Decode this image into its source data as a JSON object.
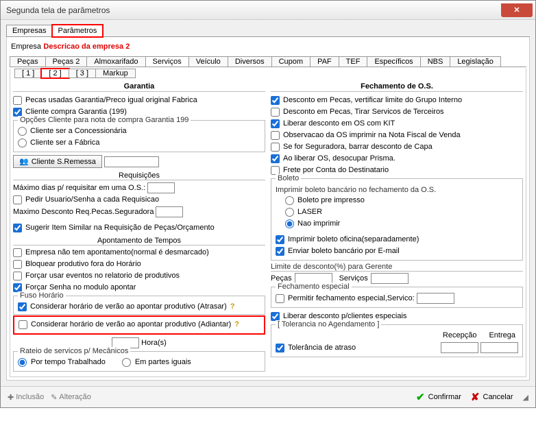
{
  "window": {
    "title": "Segunda tela de parâmetros"
  },
  "topTabs": {
    "empresas": "Empresas",
    "parametros": "Parâmetros"
  },
  "empresa": {
    "label": "Empresa",
    "value": "Descricao da empresa 2"
  },
  "subTabs": {
    "pecas": "Peças",
    "pecas2": "Peças 2",
    "almox": "Almoxarifado",
    "servicos": "Serviços",
    "veiculo": "Veículo",
    "diversos": "Diversos",
    "cupom": "Cupom",
    "paf": "PAF",
    "tef": "TEF",
    "especificos": "Específicos",
    "nbs": "NBS",
    "legislacao": "Legislação"
  },
  "subTabs2": {
    "t1": "[ 1 ]",
    "t2": "[ 2 ]",
    "t3": "[ 3 ]",
    "markup": "Markup"
  },
  "left": {
    "garantia_title": "Garantia",
    "cb_pecas_usadas": "Pecas usadas Garantia/Preco igual original Fabrica",
    "cb_cliente_compra": "Cliente compra Garantia (199)",
    "opc_legend": "Opções Cliente para nota de compra Garantia 199",
    "rb_concess": "Cliente ser a Concessionária",
    "rb_fabrica": "Cliente ser a Fábrica",
    "btn_sremessa": "Cliente S.Remessa",
    "req_title": "Requisições",
    "max_dias": "Máximo dias p/ requisitar em uma O.S.:",
    "cb_pedir_user": "Pedir Usuario/Senha a cada Requisicao",
    "max_desc": "Maximo Desconto Req.Pecas.Seguradora",
    "cb_sugerir": "Sugerir Item Similar na Requisição de Peças/Orçamento",
    "apont_title": "Apontamento de Tempos",
    "cb_apont1": "Empresa não tem apontamento(normal é desmarcado)",
    "cb_apont2": "Bloquear produtivo fora do Horário",
    "cb_apont3": "Forçar usar eventos no relatorio de produtivos",
    "cb_apont4": "Forçar Senha no modulo apontar",
    "fuso_legend": "Fuso Horário",
    "cb_fuso1": "Considerar horário de verão ao apontar produtivo (Atrasar)",
    "cb_fuso2": "Considerar horário de verão ao apontar produtivo (Adiantar)",
    "horas": "Hora(s)",
    "rateio_legend": "Rateio de servicos p/ Mecânicos",
    "rb_tempo": "Por tempo Trabalhado",
    "rb_partes": "Em partes iguais"
  },
  "right": {
    "fech_title": "Fechamento de O.S.",
    "cb1": "Desconto em Pecas, vertificar limite do Grupo Interno",
    "cb2": "Desconto em Pecas, Tirar Servicos de Terceiros",
    "cb3": "Liberar desconto em OS com KIT",
    "cb4": "Observacao da OS imprimir na Nota Fiscal de Venda",
    "cb5": "Se for Seguradora, barrar desconto de Capa",
    "cb6": "Ao liberar OS, desocupar Prisma.",
    "cb7": "Frete por Conta do Destinatario",
    "boleto_legend": "Boleto",
    "boleto_sub": "Imprimir boleto bancário no fechamento da O.S.",
    "rb_b1": "Boleto pre impresso",
    "rb_b2": "LASER",
    "rb_b3": "Nao imprimir",
    "cb_boleto_ofic": "Imprimir boleto oficina(separadamente)",
    "cb_boleto_mail": "Enviar boleto bancário por E-mail",
    "limite_lbl": "Limite de desconto(%) para Gerente",
    "pecas_lbl": "Peças",
    "servicos_lbl": "Serviços",
    "fech_esp_legend": "Fechamento especial",
    "cb_fech_esp": "Permitir fechamento especial,Servico:",
    "cb_liberar": "Liberar desconto p/clientes especiais",
    "tol_legend": "[ Tolerancia no Agendamento ]",
    "recepcao": "Recepção",
    "entrega": "Entrega",
    "cb_tol": "Tolerância de atraso"
  },
  "footer": {
    "inclusao": "Inclusão",
    "alteracao": "Alteração",
    "confirmar": "Confirmar",
    "cancelar": "Cancelar"
  }
}
